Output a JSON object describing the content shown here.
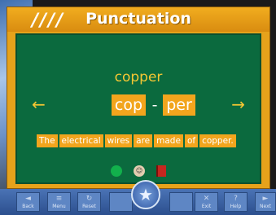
{
  "header": {
    "stripes": "////",
    "title": "Punctuation"
  },
  "lesson": {
    "word": "copper",
    "syllables": [
      "cop",
      "per"
    ],
    "separator": "-",
    "sentence": [
      "The",
      "electrical",
      "wires",
      "are",
      "made",
      "of",
      "copper."
    ]
  },
  "icons": {
    "left_arrow": "left-arrow-icon",
    "right_arrow": "right-arrow-icon",
    "status": [
      "green-dot-icon",
      "teacher-face-icon",
      "red-book-icon"
    ]
  },
  "toolbar": {
    "back": "Back",
    "menu": "Menu",
    "reset": "Reset",
    "exit": "Exit",
    "help": "Help",
    "next": "Next",
    "center_icon": "star-icon"
  },
  "colors": {
    "board": "#0b6a3e",
    "accent": "#f2a51d",
    "toolbar": "#2c4f8e"
  }
}
